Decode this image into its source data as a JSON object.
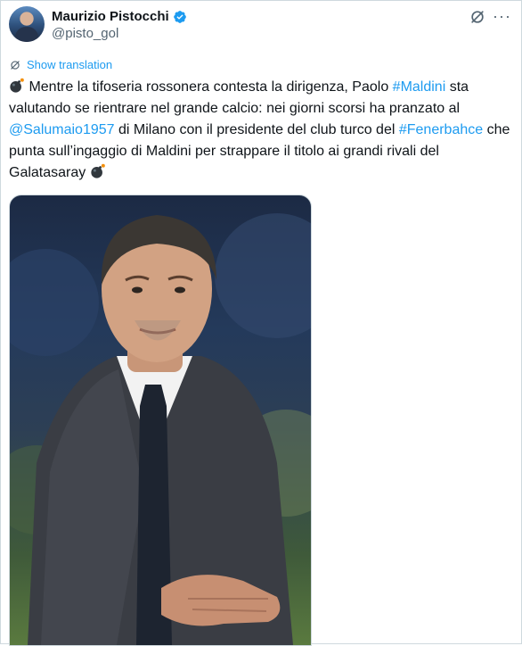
{
  "author": {
    "display_name": "Maurizio Pistocchi",
    "handle": "@pisto_gol",
    "verified": true
  },
  "actions": {
    "grok_icon": "grok-icon",
    "more_icon": "more-icon"
  },
  "translate": {
    "label": "Show translation"
  },
  "tweet": {
    "t1": " Mentre la tifoseria rossonera contesta la dirigenza, Paolo ",
    "h1": "#Maldini",
    "t2": " sta valutando se rientrare nel grande calcio: nei giorni scorsi ha pranzato al ",
    "m1": "@Salumaio1957",
    "t3": " di Milano con il presidente del club turco del ",
    "h2": "#Fenerbahce",
    "t4": " che punta sull’ingaggio di Maldini per strappare il titolo ai grandi rivali del Galatasaray "
  },
  "colors": {
    "link": "#1d9bf0",
    "text": "#0f1419",
    "muted": "#536471",
    "border": "#cfd9de"
  }
}
